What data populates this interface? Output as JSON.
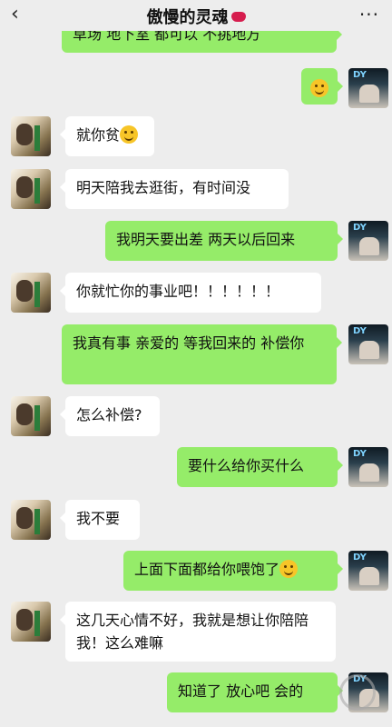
{
  "header": {
    "back_glyph": "‹",
    "title": "傲慢的灵魂",
    "more_glyph": "···"
  },
  "messages": [
    {
      "side": "right",
      "text": "草场 地下室 都可以 不挑地方"
    },
    {
      "side": "right",
      "text": "",
      "emoji": "thinking-emoji"
    },
    {
      "side": "left",
      "text": "就你贫",
      "emoji": "grin-emoji"
    },
    {
      "side": "left",
      "text": "明天陪我去逛街，有时间没"
    },
    {
      "side": "right",
      "text": "我明天要出差 两天以后回来"
    },
    {
      "side": "left",
      "text": "你就忙你的事业吧！！！！！！"
    },
    {
      "side": "right",
      "text": "我真有事  亲爱的  等我回来的 补偿你"
    },
    {
      "side": "left",
      "text": "怎么补偿?"
    },
    {
      "side": "right",
      "text": "要什么给你买什么"
    },
    {
      "side": "left",
      "text": "我不要"
    },
    {
      "side": "right",
      "text": "上面下面都给你喂饱了",
      "emoji": "laugh-tears-emoji"
    },
    {
      "side": "left",
      "text": "这几天心情不好，我就是想让你陪陪我！这么难嘛"
    },
    {
      "side": "right",
      "text": "知道了 放心吧 会的"
    }
  ],
  "avatar_right_text": "DY"
}
